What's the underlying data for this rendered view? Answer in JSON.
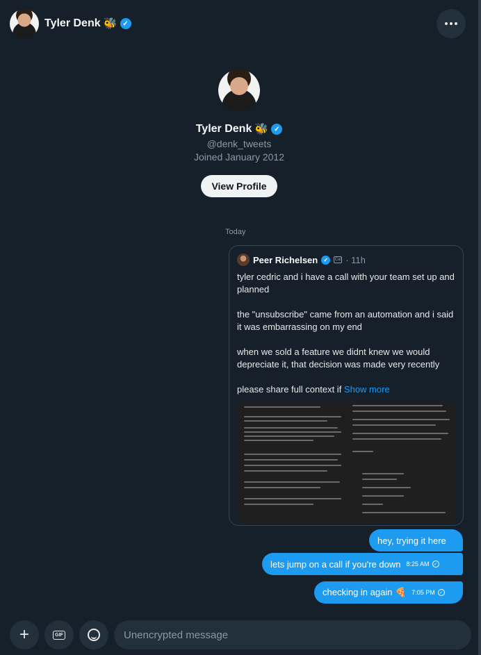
{
  "header": {
    "name": "Tyler Denk",
    "emoji": "🐝",
    "verified_mark": "✓",
    "more_icon": "more-horizontal-icon"
  },
  "profile": {
    "name": "Tyler Denk",
    "emoji": "🐝",
    "handle": "@denk_tweets",
    "joined": "Joined January 2012",
    "view_profile_label": "View Profile"
  },
  "conversation": {
    "date_divider": "Today",
    "quoted_tweet": {
      "author": "Peer Richelsen",
      "badge": "Cal",
      "time": "11h",
      "paragraphs": [
        "tyler cedric and i have a call with your team set up and planned",
        "the \"unsubscribe\" came from an automation and i said it was embarrassing on my end",
        "when we sold a feature we didnt knew we  would depreciate it, that decision was made very recently"
      ],
      "truncated_text": "please share full context if ",
      "show_more": "Show more"
    },
    "messages": [
      {
        "text": "hey, trying it here",
        "time": ""
      },
      {
        "text": "lets jump on a call if you're down",
        "time": "8:25 AM"
      },
      {
        "text": "checking in again 🍕",
        "time": "7:05 PM"
      }
    ]
  },
  "composer": {
    "placeholder": "Unencrypted message",
    "gif_label": "GIF"
  },
  "colors": {
    "background": "#15202b",
    "accent": "#1d9bf0",
    "muted_text": "#8b98a5"
  }
}
